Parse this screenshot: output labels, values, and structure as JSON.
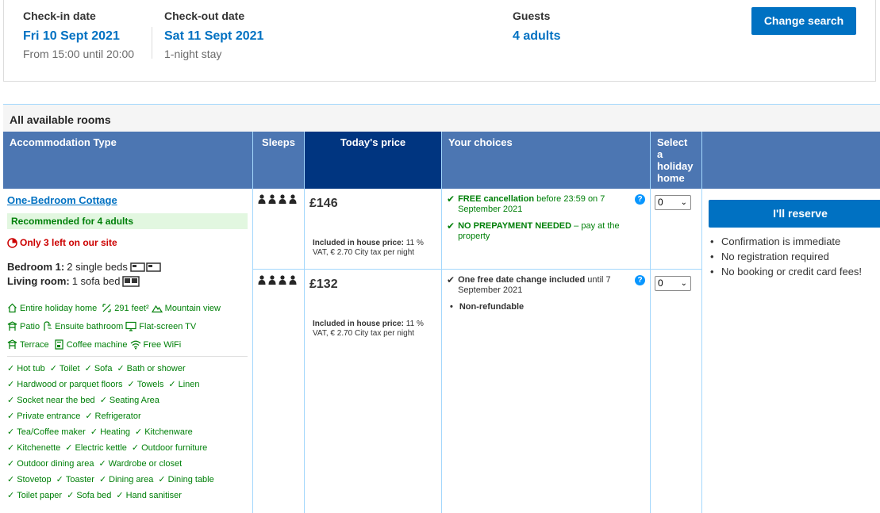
{
  "search": {
    "checkin_label": "Check-in date",
    "checkin_value": "Fri 10 Sept 2021",
    "checkin_sub": "From 15:00 until 20:00",
    "checkout_label": "Check-out date",
    "checkout_value": "Sat 11 Sept 2021",
    "checkout_sub": "1-night stay",
    "guests_label": "Guests",
    "guests_value": "4 adults",
    "change_button": "Change search"
  },
  "rooms": {
    "title": "All available rooms",
    "headers": {
      "type": "Accommodation Type",
      "sleeps": "Sleeps",
      "price": "Today's price",
      "choices": "Your choices",
      "select": "Select a holiday home"
    },
    "room": {
      "name": "One-Bedroom Cottage",
      "recommended": "Recommended for 4 adults",
      "scarcity": "Only 3 left on our site",
      "bedroom_label": "Bedroom 1:",
      "bedroom_value": "2 single beds",
      "living_label": "Living room:",
      "living_value": "1 sofa bed",
      "facilities": [
        [
          "Entire holiday home",
          "291 feet²",
          "Mountain view"
        ],
        [
          "Patio",
          "Ensuite bathroom",
          "Flat-screen TV"
        ],
        [
          "Terrace",
          "Coffee machine",
          "Free WiFi"
        ]
      ],
      "amenities": [
        [
          "Hot tub",
          "Toilet",
          "Sofa",
          "Bath or shower"
        ],
        [
          "Hardwood or parquet floors",
          "Towels",
          "Linen"
        ],
        [
          "Socket near the bed",
          "Seating Area"
        ],
        [
          "Private entrance",
          "Refrigerator"
        ],
        [
          "Tea/Coffee maker",
          "Heating",
          "Kitchenware"
        ],
        [
          "Kitchenette",
          "Electric kettle",
          "Outdoor furniture"
        ],
        [
          "Outdoor dining area",
          "Wardrobe or closet"
        ],
        [
          "Stovetop",
          "Toaster",
          "Dining area",
          "Dining table"
        ],
        [
          "Toilet paper",
          "Sofa bed",
          "Hand sanitiser"
        ]
      ]
    },
    "options": [
      {
        "price": "£146",
        "tax_label": "Included in house price:",
        "tax_text": "11 % VAT, € 2.70 City tax per night",
        "choice1_bold": "FREE cancellation",
        "choice1_rest": "before 23:59 on 7 September 2021",
        "choice2_bold": "NO PREPAYMENT NEEDED",
        "choice2_rest": "– pay at the property",
        "select_value": "0"
      },
      {
        "price": "£132",
        "tax_label": "Included in house price:",
        "tax_text": "11 % VAT, € 2.70 City tax per night",
        "choice1_bold": "One free date change included",
        "choice1_rest": "until 7 September 2021",
        "nonref": "Non-refundable",
        "select_value": "0"
      }
    ],
    "reserve_button": "I'll reserve",
    "reserve_bullets": [
      "Confirmation is immediate",
      "No registration required",
      "No booking or credit card fees!"
    ],
    "help_glyph": "?"
  },
  "colors": {
    "brand_blue": "#0071c2",
    "header_blue": "#4c76b2",
    "dark_blue": "#003580",
    "green": "#008009",
    "red": "#cc0000"
  }
}
